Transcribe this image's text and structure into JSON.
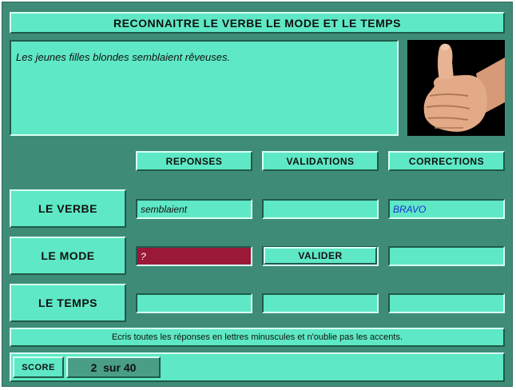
{
  "title": "RECONNAITRE LE VERBE LE MODE ET LE TEMPS",
  "sentence": "Les jeunes filles blondes semblaient rêveuses.",
  "image_icon": "thumbs-up-hand",
  "columns": {
    "reponses": "REPONSES",
    "validations": "VALIDATIONS",
    "corrections": "CORRECTIONS"
  },
  "rows": {
    "verbe": {
      "label": "LE VERBE",
      "reponse": "semblaient",
      "validation": "",
      "correction": "BRAVO"
    },
    "mode": {
      "label": "LE MODE",
      "reponse": "?",
      "validate_button": "VALIDER",
      "correction": ""
    },
    "temps": {
      "label": "LE TEMPS",
      "reponse": "",
      "validation": "",
      "correction": ""
    }
  },
  "instructions": "Ecris toutes les réponses en lettres minuscules et n'oublie pas les accents.",
  "score": {
    "label": "SCORE",
    "value": "2  sur 40"
  },
  "colors": {
    "background": "#3e8c77",
    "panel": "#5ee8c5",
    "active_field": "#9a1838",
    "correct_text": "#1a2bd8"
  }
}
